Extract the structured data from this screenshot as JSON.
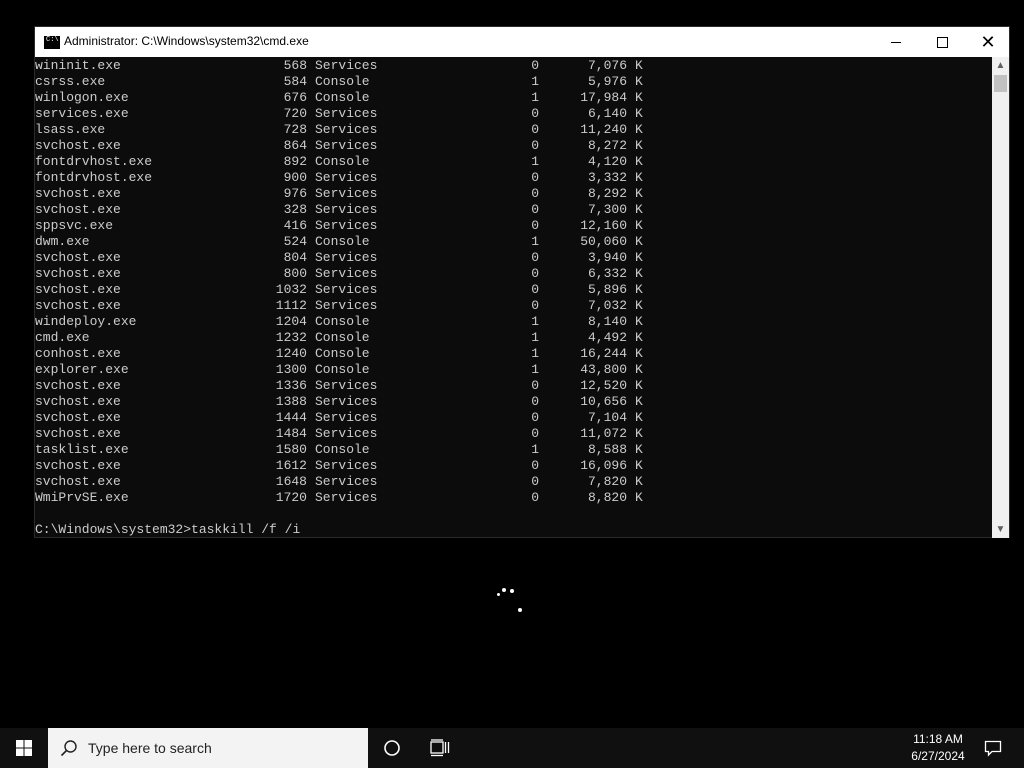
{
  "window": {
    "title": "Administrator: C:\\Windows\\system32\\cmd.exe",
    "close_glyph": "✕"
  },
  "processes": [
    {
      "name": "wininit.exe",
      "pid": "568",
      "session": "Services",
      "session_num": "0",
      "mem": "7,076",
      "unit": "K"
    },
    {
      "name": "csrss.exe",
      "pid": "584",
      "session": "Console",
      "session_num": "1",
      "mem": "5,976",
      "unit": "K"
    },
    {
      "name": "winlogon.exe",
      "pid": "676",
      "session": "Console",
      "session_num": "1",
      "mem": "17,984",
      "unit": "K"
    },
    {
      "name": "services.exe",
      "pid": "720",
      "session": "Services",
      "session_num": "0",
      "mem": "6,140",
      "unit": "K"
    },
    {
      "name": "lsass.exe",
      "pid": "728",
      "session": "Services",
      "session_num": "0",
      "mem": "11,240",
      "unit": "K"
    },
    {
      "name": "svchost.exe",
      "pid": "864",
      "session": "Services",
      "session_num": "0",
      "mem": "8,272",
      "unit": "K"
    },
    {
      "name": "fontdrvhost.exe",
      "pid": "892",
      "session": "Console",
      "session_num": "1",
      "mem": "4,120",
      "unit": "K"
    },
    {
      "name": "fontdrvhost.exe",
      "pid": "900",
      "session": "Services",
      "session_num": "0",
      "mem": "3,332",
      "unit": "K"
    },
    {
      "name": "svchost.exe",
      "pid": "976",
      "session": "Services",
      "session_num": "0",
      "mem": "8,292",
      "unit": "K"
    },
    {
      "name": "svchost.exe",
      "pid": "328",
      "session": "Services",
      "session_num": "0",
      "mem": "7,300",
      "unit": "K"
    },
    {
      "name": "sppsvc.exe",
      "pid": "416",
      "session": "Services",
      "session_num": "0",
      "mem": "12,160",
      "unit": "K"
    },
    {
      "name": "dwm.exe",
      "pid": "524",
      "session": "Console",
      "session_num": "1",
      "mem": "50,060",
      "unit": "K"
    },
    {
      "name": "svchost.exe",
      "pid": "804",
      "session": "Services",
      "session_num": "0",
      "mem": "3,940",
      "unit": "K"
    },
    {
      "name": "svchost.exe",
      "pid": "800",
      "session": "Services",
      "session_num": "0",
      "mem": "6,332",
      "unit": "K"
    },
    {
      "name": "svchost.exe",
      "pid": "1032",
      "session": "Services",
      "session_num": "0",
      "mem": "5,896",
      "unit": "K"
    },
    {
      "name": "svchost.exe",
      "pid": "1112",
      "session": "Services",
      "session_num": "0",
      "mem": "7,032",
      "unit": "K"
    },
    {
      "name": "windeploy.exe",
      "pid": "1204",
      "session": "Console",
      "session_num": "1",
      "mem": "8,140",
      "unit": "K"
    },
    {
      "name": "cmd.exe",
      "pid": "1232",
      "session": "Console",
      "session_num": "1",
      "mem": "4,492",
      "unit": "K"
    },
    {
      "name": "conhost.exe",
      "pid": "1240",
      "session": "Console",
      "session_num": "1",
      "mem": "16,244",
      "unit": "K"
    },
    {
      "name": "explorer.exe",
      "pid": "1300",
      "session": "Console",
      "session_num": "1",
      "mem": "43,800",
      "unit": "K"
    },
    {
      "name": "svchost.exe",
      "pid": "1336",
      "session": "Services",
      "session_num": "0",
      "mem": "12,520",
      "unit": "K"
    },
    {
      "name": "svchost.exe",
      "pid": "1388",
      "session": "Services",
      "session_num": "0",
      "mem": "10,656",
      "unit": "K"
    },
    {
      "name": "svchost.exe",
      "pid": "1444",
      "session": "Services",
      "session_num": "0",
      "mem": "7,104",
      "unit": "K"
    },
    {
      "name": "svchost.exe",
      "pid": "1484",
      "session": "Services",
      "session_num": "0",
      "mem": "11,072",
      "unit": "K"
    },
    {
      "name": "tasklist.exe",
      "pid": "1580",
      "session": "Console",
      "session_num": "1",
      "mem": "8,588",
      "unit": "K"
    },
    {
      "name": "svchost.exe",
      "pid": "1612",
      "session": "Services",
      "session_num": "0",
      "mem": "16,096",
      "unit": "K"
    },
    {
      "name": "svchost.exe",
      "pid": "1648",
      "session": "Services",
      "session_num": "0",
      "mem": "7,820",
      "unit": "K"
    },
    {
      "name": "WmiPrvSE.exe",
      "pid": "1720",
      "session": "Services",
      "session_num": "0",
      "mem": "8,820",
      "unit": "K"
    }
  ],
  "prompt": "C:\\Windows\\system32>taskkill /f /i",
  "taskbar": {
    "search_placeholder": "Type here to search",
    "time": "11:18 AM",
    "date": "6/27/2024"
  },
  "icons": {
    "start": "windows-logo-icon",
    "search": "magnifier-icon",
    "cortana": "circle-icon",
    "taskview": "task-view-icon",
    "notifications": "speech-bubble-icon"
  }
}
